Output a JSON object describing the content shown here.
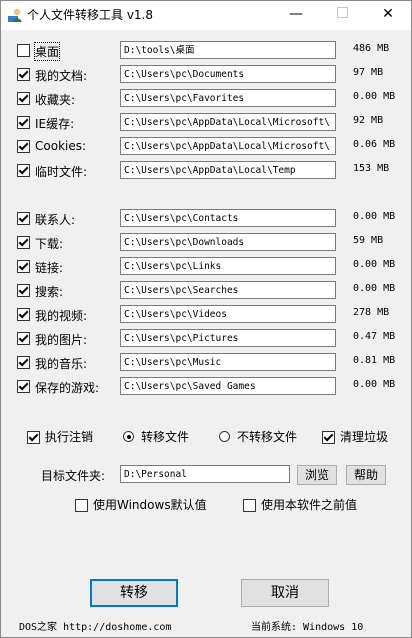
{
  "window": {
    "title": "个人文件转移工具 v1.8",
    "min_glyph": "—",
    "close_glyph": "✕"
  },
  "folders_group1": [
    {
      "label": "桌面",
      "checked": false,
      "path": "D:\\tools\\桌面",
      "size": "486 MB"
    },
    {
      "label": "我的文档:",
      "checked": true,
      "path": "C:\\Users\\pc\\Documents",
      "size": "97 MB"
    },
    {
      "label": "收藏夹:",
      "checked": true,
      "path": "C:\\Users\\pc\\Favorites",
      "size": "0.00 MB"
    },
    {
      "label": "IE缓存:",
      "checked": true,
      "path": "C:\\Users\\pc\\AppData\\Local\\Microsoft\\",
      "size": "92 MB"
    },
    {
      "label": "Cookies:",
      "checked": true,
      "path": "C:\\Users\\pc\\AppData\\Local\\Microsoft\\",
      "size": "0.06 MB"
    },
    {
      "label": "临时文件:",
      "checked": true,
      "path": "C:\\Users\\pc\\AppData\\Local\\Temp",
      "size": "153 MB"
    }
  ],
  "folders_group2": [
    {
      "label": "联系人:",
      "checked": true,
      "path": "C:\\Users\\pc\\Contacts",
      "size": "0.00 MB"
    },
    {
      "label": "下载:",
      "checked": true,
      "path": "C:\\Users\\pc\\Downloads",
      "size": "59 MB"
    },
    {
      "label": "链接:",
      "checked": true,
      "path": "C:\\Users\\pc\\Links",
      "size": "0.00 MB"
    },
    {
      "label": "搜索:",
      "checked": true,
      "path": "C:\\Users\\pc\\Searches",
      "size": "0.00 MB"
    },
    {
      "label": "我的视频:",
      "checked": true,
      "path": "C:\\Users\\pc\\Videos",
      "size": "278 MB"
    },
    {
      "label": "我的图片:",
      "checked": true,
      "path": "C:\\Users\\pc\\Pictures",
      "size": "0.47 MB"
    },
    {
      "label": "我的音乐:",
      "checked": true,
      "path": "C:\\Users\\pc\\Music",
      "size": "0.81 MB"
    },
    {
      "label": "保存的游戏:",
      "checked": true,
      "path": "C:\\Users\\pc\\Saved Games",
      "size": "0.00 MB"
    }
  ],
  "options": {
    "logout": {
      "label": "执行注销",
      "checked": true
    },
    "transfer": {
      "label": "转移文件",
      "selected": true
    },
    "no_transfer": {
      "label": "不转移文件",
      "selected": false
    },
    "cleanup": {
      "label": "清理垃圾",
      "checked": true
    }
  },
  "target": {
    "label": "目标文件夹:",
    "value": "D:\\Personal",
    "browse": "浏览",
    "help": "帮助"
  },
  "defaults": {
    "windows_default": {
      "label": "使用Windows默认值",
      "checked": false
    },
    "previous": {
      "label": "使用本软件之前值",
      "checked": false
    }
  },
  "actions": {
    "transfer": "转移",
    "cancel": "取消"
  },
  "footer": {
    "site": "DOS之家 http://doshome.com",
    "system": "当前系统: Windows 10"
  }
}
